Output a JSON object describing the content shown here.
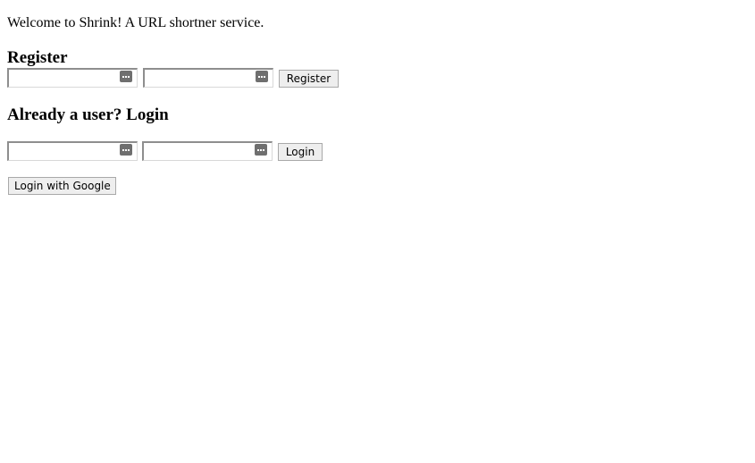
{
  "welcome_text": "Welcome to Shrink! A URL shortner service.",
  "register": {
    "heading": "Register",
    "username_value": "",
    "password_value": "",
    "button_label": "Register"
  },
  "login": {
    "heading": "Already a user? Login",
    "username_value": "",
    "password_value": "",
    "button_label": "Login"
  },
  "google_login": {
    "button_label": "Login with Google"
  },
  "icons": {
    "field_icon": "password-manager-key-icon"
  },
  "colors": {
    "background": "#ffffff",
    "text": "#000000",
    "button_bg": "#eeeeee",
    "icon": "#6f6f6f"
  }
}
